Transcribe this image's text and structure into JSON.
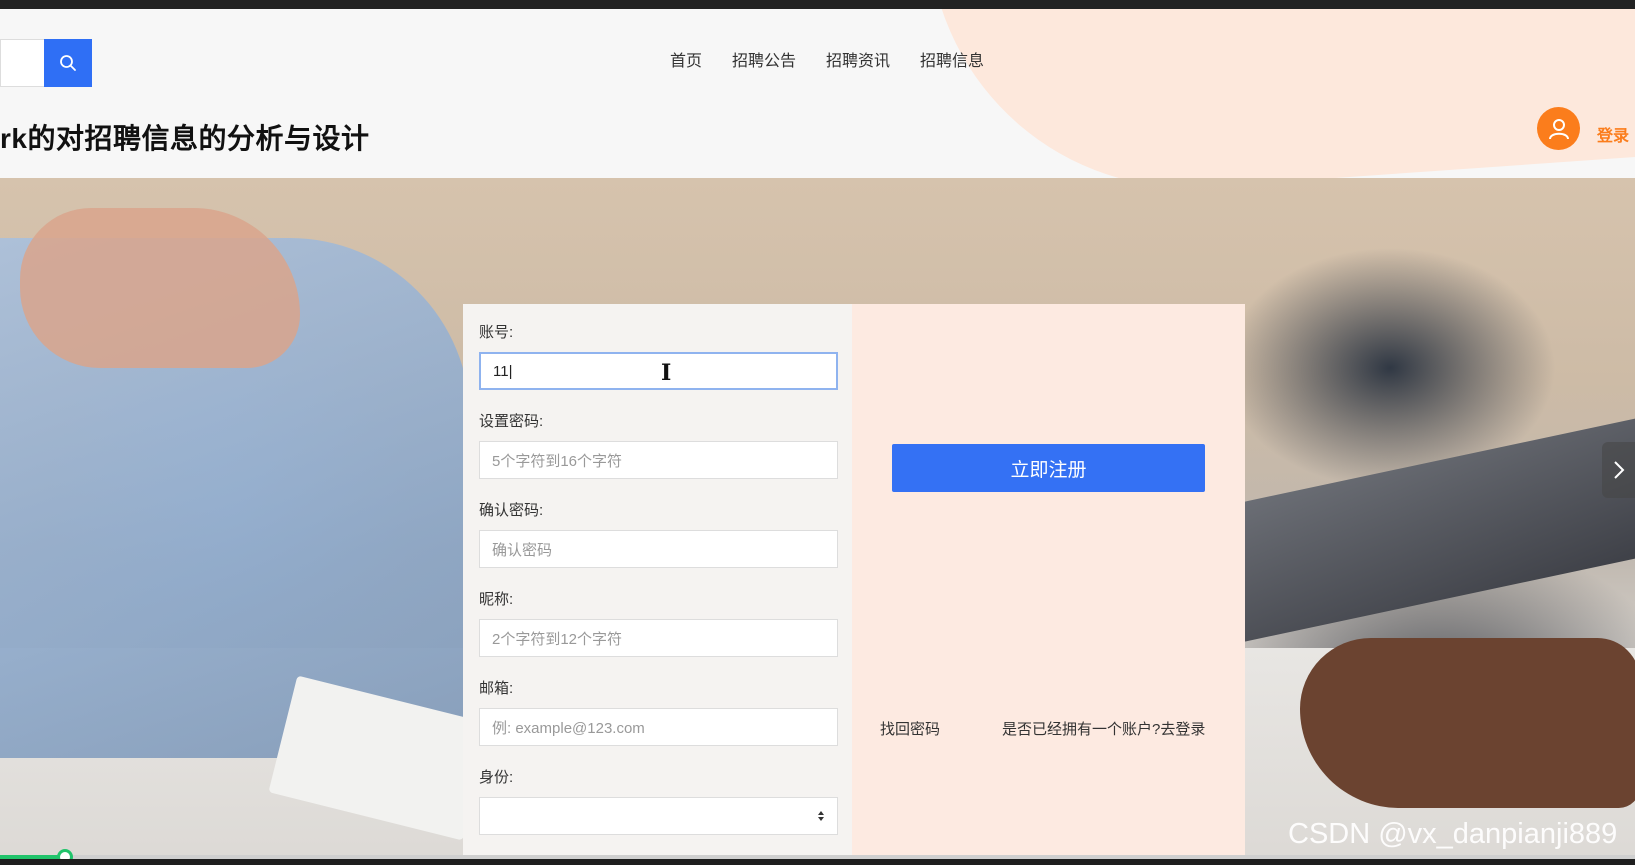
{
  "header": {
    "nav": [
      "首页",
      "招聘公告",
      "招聘资讯",
      "招聘信息"
    ],
    "site_title": "rk的对招聘信息的分析与设计",
    "login_label": "登录",
    "search_icon": "search-icon",
    "avatar_icon": "user-icon"
  },
  "form": {
    "account": {
      "label": "账号:",
      "value": "11|"
    },
    "password": {
      "label": "设置密码:",
      "placeholder": "5个字符到16个字符"
    },
    "confirm": {
      "label": "确认密码:",
      "placeholder": "确认密码"
    },
    "nickname": {
      "label": "昵称:",
      "placeholder": "2个字符到12个字符"
    },
    "email": {
      "label": "邮箱:",
      "placeholder": "例: example@123.com"
    },
    "identity": {
      "label": "身份:",
      "value": ""
    }
  },
  "actions": {
    "register": "立即注册",
    "forgot": "找回密码",
    "has_account": "是否已经拥有一个账户?去登录"
  },
  "carousel": {
    "next_icon": "chevron-right-icon"
  },
  "watermark": "CSDN @vx_danpianji889",
  "video": {
    "progress": 0.04
  },
  "colors": {
    "accent": "#2f6ff5",
    "orange": "#fb7d1c",
    "progress": "#21c46b"
  }
}
